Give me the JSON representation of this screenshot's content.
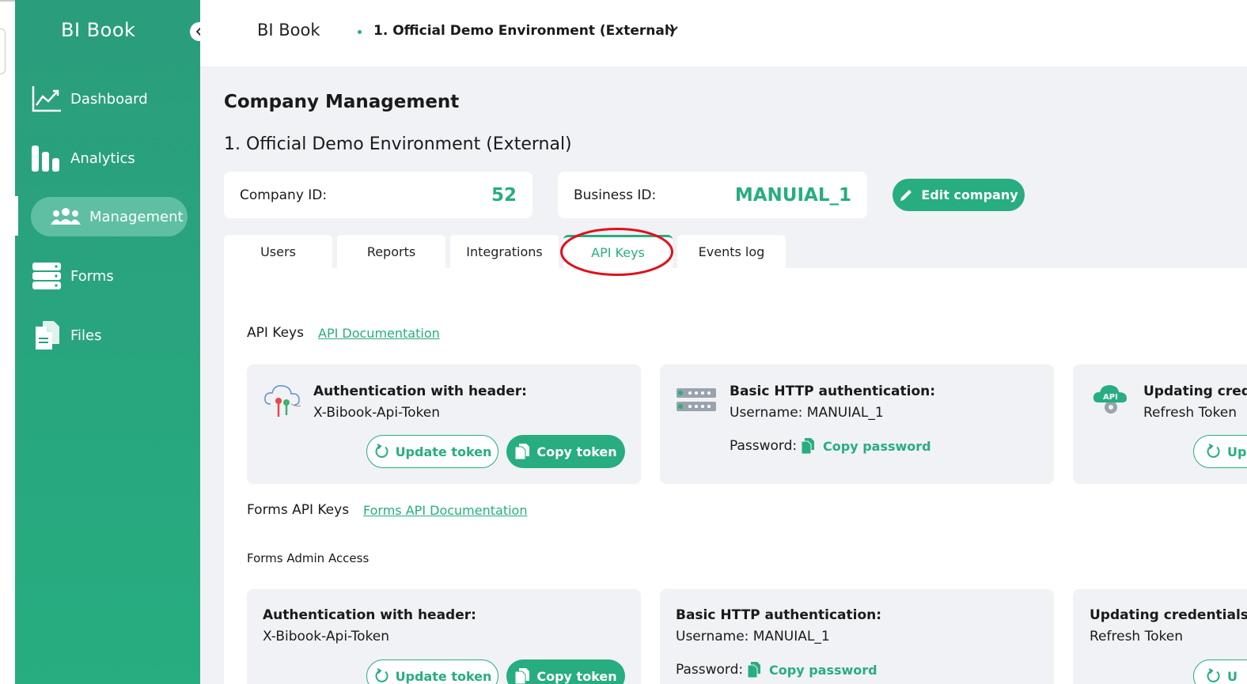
{
  "app": {
    "logo": "BI Book"
  },
  "sidebar": {
    "items": [
      {
        "label": "Dashboard",
        "icon": "line-chart-icon"
      },
      {
        "label": "Analytics",
        "icon": "bar-chart-icon"
      },
      {
        "label": "Management",
        "icon": "users-icon",
        "active": true
      },
      {
        "label": "Forms",
        "icon": "server-stack-icon"
      },
      {
        "label": "Files",
        "icon": "files-icon"
      }
    ]
  },
  "topbar": {
    "brand": "BI Book",
    "environment": "1. Official Demo Environment (External)"
  },
  "main": {
    "title": "Company Management",
    "environment_title": "1. Official Demo Environment (External)",
    "company_id_label": "Company ID:",
    "company_id_value": "52",
    "business_id_label": "Business ID:",
    "business_id_value": "MANUIAL_1",
    "edit_button": "Edit company",
    "tabs": [
      {
        "label": "Users"
      },
      {
        "label": "Reports"
      },
      {
        "label": "Integrations"
      },
      {
        "label": "API Keys",
        "active": true
      },
      {
        "label": "Events log"
      }
    ]
  },
  "api_keys": {
    "heading": "API Keys",
    "doc_link": "API Documentation",
    "cards": [
      {
        "title": "Authentication with header:",
        "text": "X-Bibook-Api-Token",
        "update_btn": "Update token",
        "copy_btn": "Copy token"
      },
      {
        "title": "Basic HTTP authentication:",
        "text": "Username: MANUIAL_1",
        "password_label": "Password:",
        "password_link": "Copy password"
      },
      {
        "title": "Updating cred",
        "text": "Refresh Token",
        "update_btn": "Up"
      }
    ]
  },
  "forms_api_keys": {
    "heading": "Forms API Keys",
    "doc_link": "Forms API Documentation",
    "subheading": "Forms Admin Access",
    "cards": [
      {
        "title": "Authentication with header:",
        "text": "X-Bibook-Api-Token",
        "update_btn": "Update token",
        "copy_btn": "Copy token"
      },
      {
        "title": "Basic HTTP authentication:",
        "text": "Username: MANUIAL_1",
        "password_label": "Password:",
        "password_link": "Copy password"
      },
      {
        "title": "Updating credentials",
        "text": "Refresh Token",
        "update_btn": "U"
      }
    ]
  },
  "colors": {
    "accent": "#27ad80",
    "sidebar": "#2a9d7c",
    "annotation": "#e0101a"
  }
}
